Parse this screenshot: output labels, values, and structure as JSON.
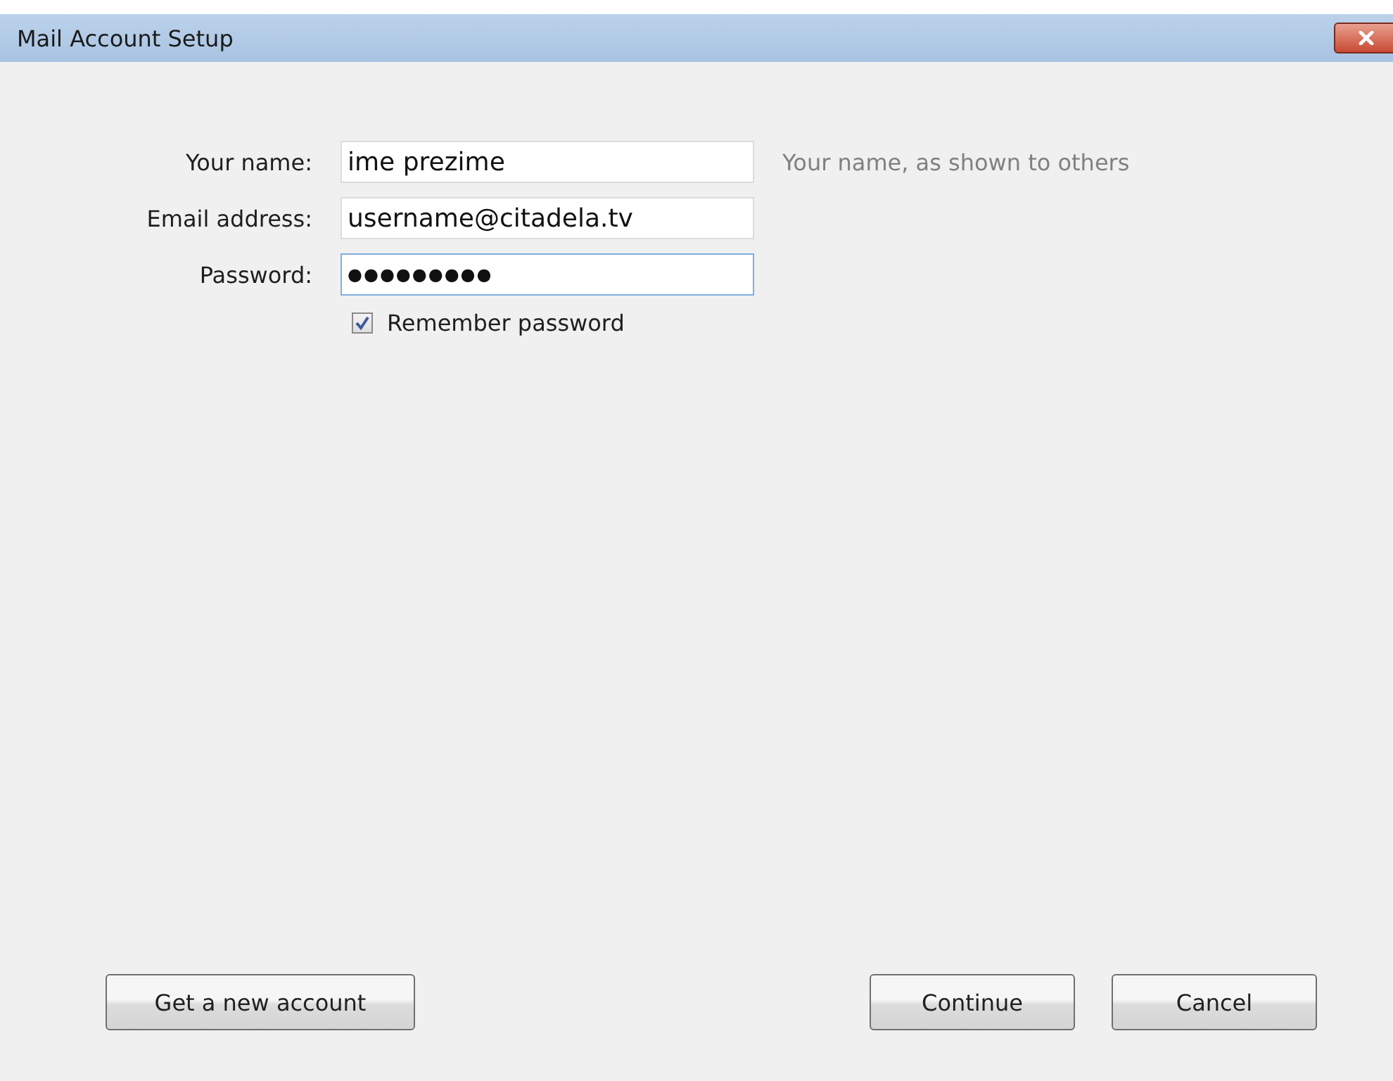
{
  "window": {
    "title": "Mail Account Setup"
  },
  "fields": [
    {
      "label": "Your name:",
      "value": "ime prezime",
      "focused": false,
      "hint": "Your name, as shown to others"
    },
    {
      "label": "Email address:",
      "value": "username@citadela.tv",
      "focused": false
    },
    {
      "label": "Password:",
      "value": "●●●●●●●●●",
      "focused": true
    }
  ],
  "remember_password": {
    "label": "Remember password",
    "checked": true
  },
  "buttons": [
    {
      "label": "Get a new account",
      "kind": "left"
    },
    {
      "label": "Continue",
      "kind": "right"
    },
    {
      "label": "Cancel",
      "kind": "right"
    }
  ]
}
